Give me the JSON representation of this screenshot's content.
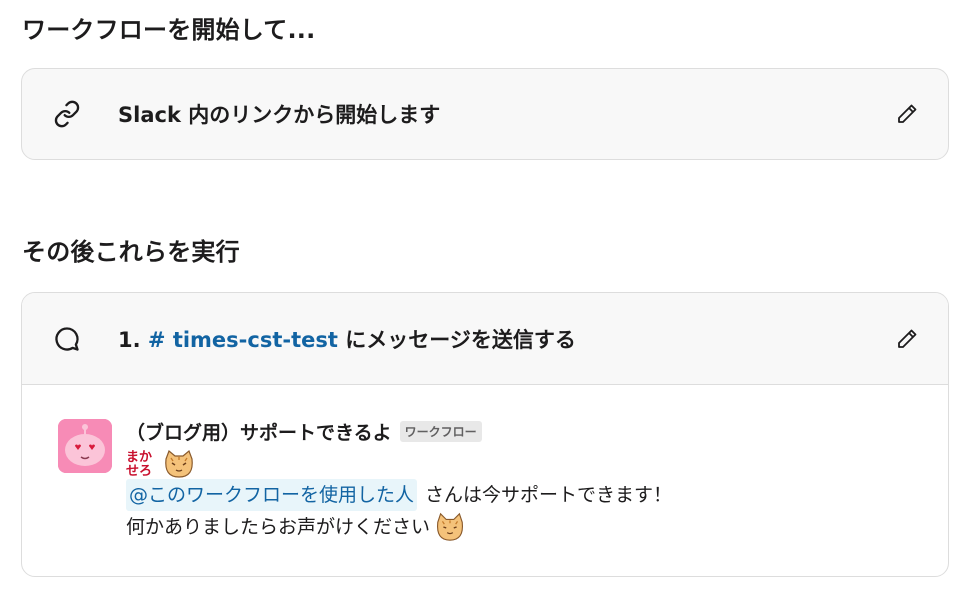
{
  "start_section": {
    "title": "ワークフローを開始して...",
    "trigger": {
      "icon": "link-icon",
      "label": "Slack 内のリンクから開始します"
    }
  },
  "then_section": {
    "title": "その後これらを実行",
    "step": {
      "icon": "message-icon",
      "number": "1.",
      "channel": "# times-cst-test",
      "action": "にメッセージを送信する"
    },
    "message": {
      "sender": "（ブログ用）サポートできるよ",
      "badge": "ワークフロー",
      "sticker_text_1": "まか",
      "sticker_text_2": "せろ",
      "mention": "@このワークフローを使用した人",
      "line1_rest": "さんは今サポートできます！",
      "line2": "何かありましたらお声がけください"
    }
  },
  "colors": {
    "link": "#1264a3",
    "badge_bg": "#e8e8e8",
    "avatar_bg": "#f78bb6",
    "sticker_red": "#c8102e"
  }
}
